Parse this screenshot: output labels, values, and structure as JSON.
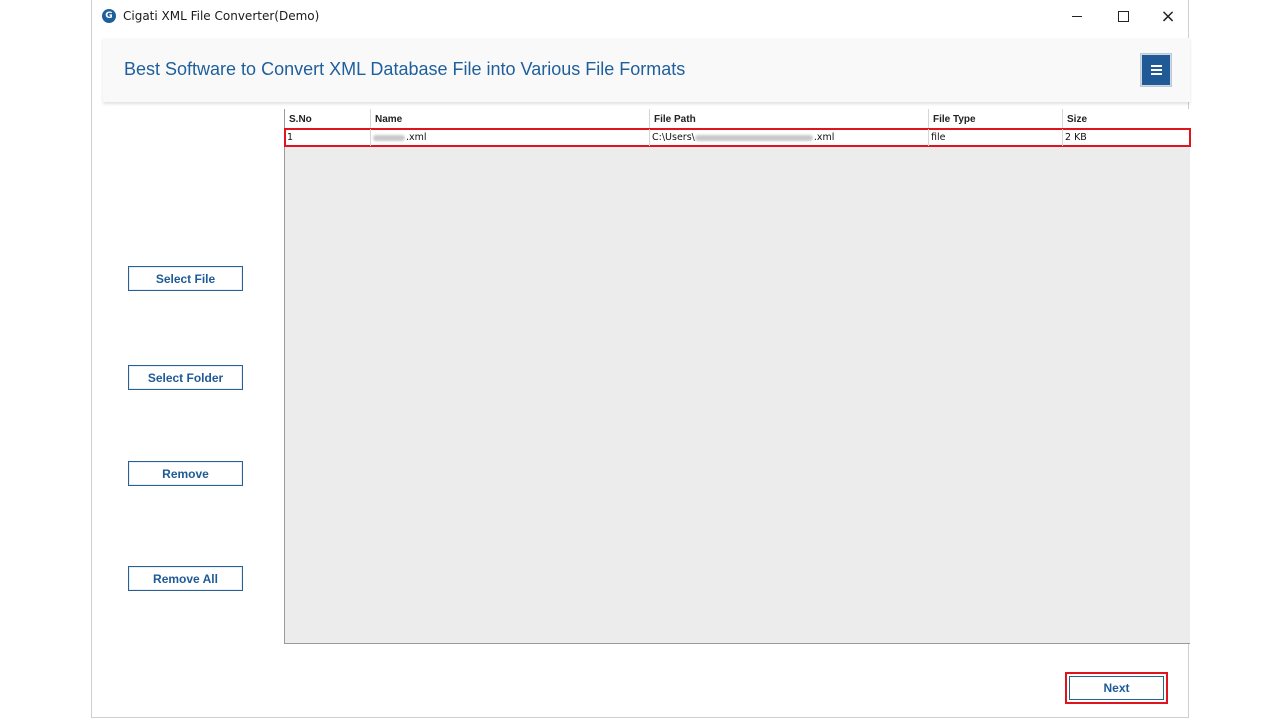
{
  "window": {
    "title": "Cigati XML File Converter(Demo)",
    "app_icon_letter": "G",
    "controls": {
      "minimize": "minimize-icon",
      "maximize": "maximize-icon",
      "close": "×"
    }
  },
  "header": {
    "title": "Best Software to Convert XML Database File into Various File Formats",
    "menu_icon": "hamburger-menu-icon"
  },
  "sidebar": {
    "select_file": "Select File",
    "select_folder": "Select Folder",
    "remove": "Remove",
    "remove_all": "Remove All"
  },
  "table": {
    "columns": [
      "S.No",
      "Name",
      "File Path",
      "File Type",
      "Size"
    ],
    "rows": [
      {
        "sno": "1",
        "name_suffix": ".xml",
        "path_prefix": "C:\\Users\\",
        "path_suffix": ".xml",
        "type": "file",
        "size": "2 KB",
        "selected": true
      }
    ]
  },
  "footer": {
    "next_label": "Next"
  },
  "colors": {
    "accent": "#1f5a97",
    "title_blue": "#1e5f9c",
    "highlight_red": "#e0141c",
    "grid_bg": "#ececec"
  }
}
